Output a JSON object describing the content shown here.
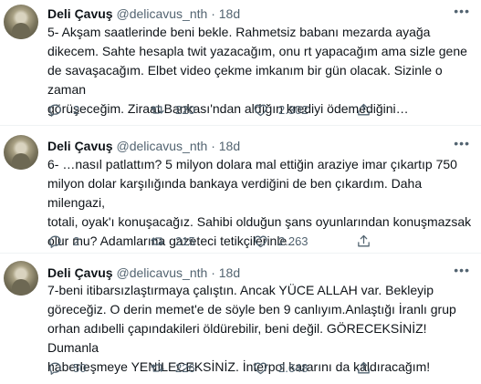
{
  "tweets": [
    {
      "name": "Deli Çavuş",
      "handle": "@delicavus_nth",
      "dot": "·",
      "time": "18d",
      "text": "5- Akşam saatlerinde beni bekle. Rahmetsiz babanı mezarda ayağa\ndikecem. Sahte hesapla twit yazacağım, onu rt yapacağım ama sizle gene\nde savaşacağım. Elbet video çekme imkanım bir gün olacak. Sizinle o zaman\ngörüşeceğim. Ziraat Bankası'ndan aldığın krediyi ödemediğini…",
      "replies": "2",
      "retweets": "220",
      "likes": "2.302"
    },
    {
      "name": "Deli Çavuş",
      "handle": "@delicavus_nth",
      "dot": "·",
      "time": "18d",
      "text": "6- …nasıl patlattım? 5 milyon dolara mal ettiğin araziye imar çıkartıp 750\nmilyon dolar karşılığında bankaya verdiğini de ben çıkardım. Daha milengazi,\ntotali, oyak'ı konuşacağız. Sahibi olduğun şans oyunlarından konuşmazsak\nolur mu? Adamlarına gazeteci tetikçilerinle…",
      "replies": "2",
      "retweets": "215",
      "likes": "2.263"
    },
    {
      "name": "Deli Çavuş",
      "handle": "@delicavus_nth",
      "dot": "·",
      "time": "18d",
      "text": "7-beni itibarsızlaştırmaya çalıştın. Ancak YÜCE ALLAH var. Bekleyip\ngöreceğiz. O derin memet'e de söyle ben 9 canlıyım.Anlaştığı İranlı grup\norhan adıbelli çapındakileri öldürebilir, beni değil. GÖRECEKSİNİZ! Dumanla\nhaberleşmeye YENİLECEKSİNİZ. İnterpol kararını da kaldıracağım!",
      "replies": "50",
      "retweets": "226",
      "likes": "2.648"
    }
  ],
  "icons": {
    "reply": "reply-icon",
    "retweet": "retweet-icon",
    "like": "heart-icon",
    "share": "share-icon",
    "more": "more-icon"
  },
  "colors": {
    "text": "#0f1419",
    "secondary": "#536471",
    "divider": "#eff3f4"
  }
}
